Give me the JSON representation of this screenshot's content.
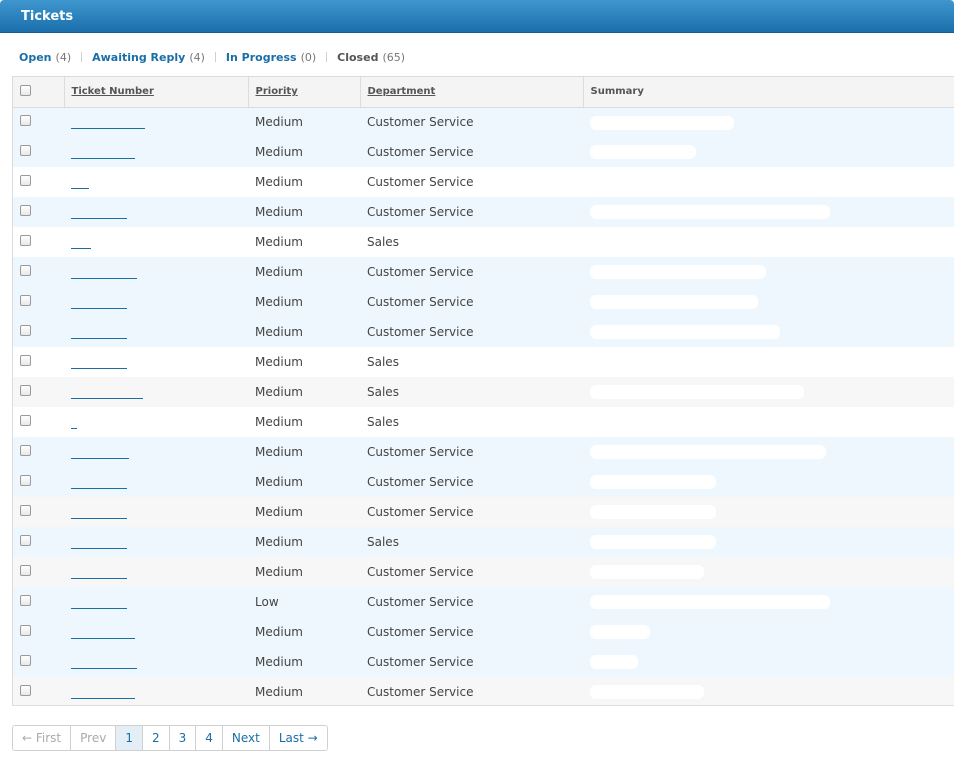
{
  "header": {
    "title": "Tickets"
  },
  "status_tabs": [
    {
      "label": "Open",
      "count": "(4)",
      "style": "link"
    },
    {
      "label": "Awaiting Reply",
      "count": "(4)",
      "style": "link"
    },
    {
      "label": "In Progress",
      "count": "(0)",
      "style": "link"
    },
    {
      "label": "Closed",
      "count": "(65)",
      "style": "plain"
    }
  ],
  "table": {
    "columns": [
      "Ticket Number",
      "Priority",
      "Department",
      "Summary"
    ],
    "rows": [
      {
        "priority": "Medium",
        "department": "Customer Service"
      },
      {
        "priority": "Medium",
        "department": "Customer Service"
      },
      {
        "priority": "Medium",
        "department": "Customer Service"
      },
      {
        "priority": "Medium",
        "department": "Customer Service"
      },
      {
        "priority": "Medium",
        "department": "Sales"
      },
      {
        "priority": "Medium",
        "department": "Customer Service"
      },
      {
        "priority": "Medium",
        "department": "Customer Service"
      },
      {
        "priority": "Medium",
        "department": "Customer Service"
      },
      {
        "priority": "Medium",
        "department": "Sales"
      },
      {
        "priority": "Medium",
        "department": "Sales"
      },
      {
        "priority": "Medium",
        "department": "Sales"
      },
      {
        "priority": "Medium",
        "department": "Customer Service"
      },
      {
        "priority": "Medium",
        "department": "Customer Service"
      },
      {
        "priority": "Medium",
        "department": "Customer Service"
      },
      {
        "priority": "Medium",
        "department": "Sales"
      },
      {
        "priority": "Medium",
        "department": "Customer Service"
      },
      {
        "priority": "Low",
        "department": "Customer Service"
      },
      {
        "priority": "Medium",
        "department": "Customer Service"
      },
      {
        "priority": "Medium",
        "department": "Customer Service"
      },
      {
        "priority": "Medium",
        "department": "Customer Service"
      }
    ]
  },
  "pagination": {
    "first": "← First",
    "prev": "Prev",
    "pages": [
      "1",
      "2",
      "3",
      "4"
    ],
    "current_page": "1",
    "next": "Next",
    "last": "Last →"
  },
  "colors": {
    "header": "#1b6fab",
    "link": "#1a6ea8",
    "row_highlight": "#eef7fd"
  }
}
